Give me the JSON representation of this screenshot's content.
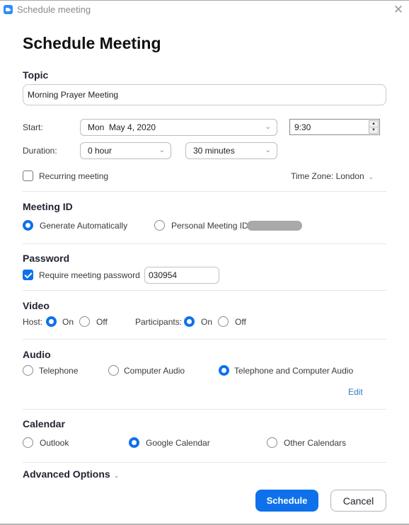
{
  "window": {
    "title": "Schedule meeting",
    "close_glyph": "✕"
  },
  "page_title": "Schedule Meeting",
  "topic": {
    "label": "Topic",
    "value": "Morning Prayer Meeting"
  },
  "start": {
    "label": "Start:",
    "date": "Mon  May 4, 2020",
    "time": "9:30"
  },
  "duration": {
    "label": "Duration:",
    "hours": "0 hour",
    "minutes": "30 minutes"
  },
  "recurring": {
    "label": "Recurring meeting",
    "checked": false
  },
  "time_zone": "Time Zone: London",
  "meeting_id": {
    "title": "Meeting ID",
    "options": [
      {
        "label": "Generate Automatically",
        "selected": true
      },
      {
        "label": "Personal Meeting ID",
        "selected": false
      }
    ]
  },
  "password": {
    "title": "Password",
    "require_label": "Require meeting password",
    "checked": true,
    "value": "030954"
  },
  "video": {
    "title": "Video",
    "host_label": "Host:",
    "participants_label": "Participants:",
    "on_label": "On",
    "off_label": "Off",
    "host": "On",
    "participants": "On"
  },
  "audio": {
    "title": "Audio",
    "options": [
      {
        "label": "Telephone",
        "selected": false
      },
      {
        "label": "Computer Audio",
        "selected": false
      },
      {
        "label": "Telephone and Computer Audio",
        "selected": true
      }
    ],
    "edit_label": "Edit"
  },
  "calendar": {
    "title": "Calendar",
    "options": [
      {
        "label": "Outlook",
        "selected": false
      },
      {
        "label": "Google Calendar",
        "selected": true
      },
      {
        "label": "Other Calendars",
        "selected": false
      }
    ]
  },
  "advanced_options": "Advanced Options",
  "buttons": {
    "schedule": "Schedule",
    "cancel": "Cancel"
  },
  "colors": {
    "accent": "#0e71eb",
    "link": "#2d7ac9"
  }
}
